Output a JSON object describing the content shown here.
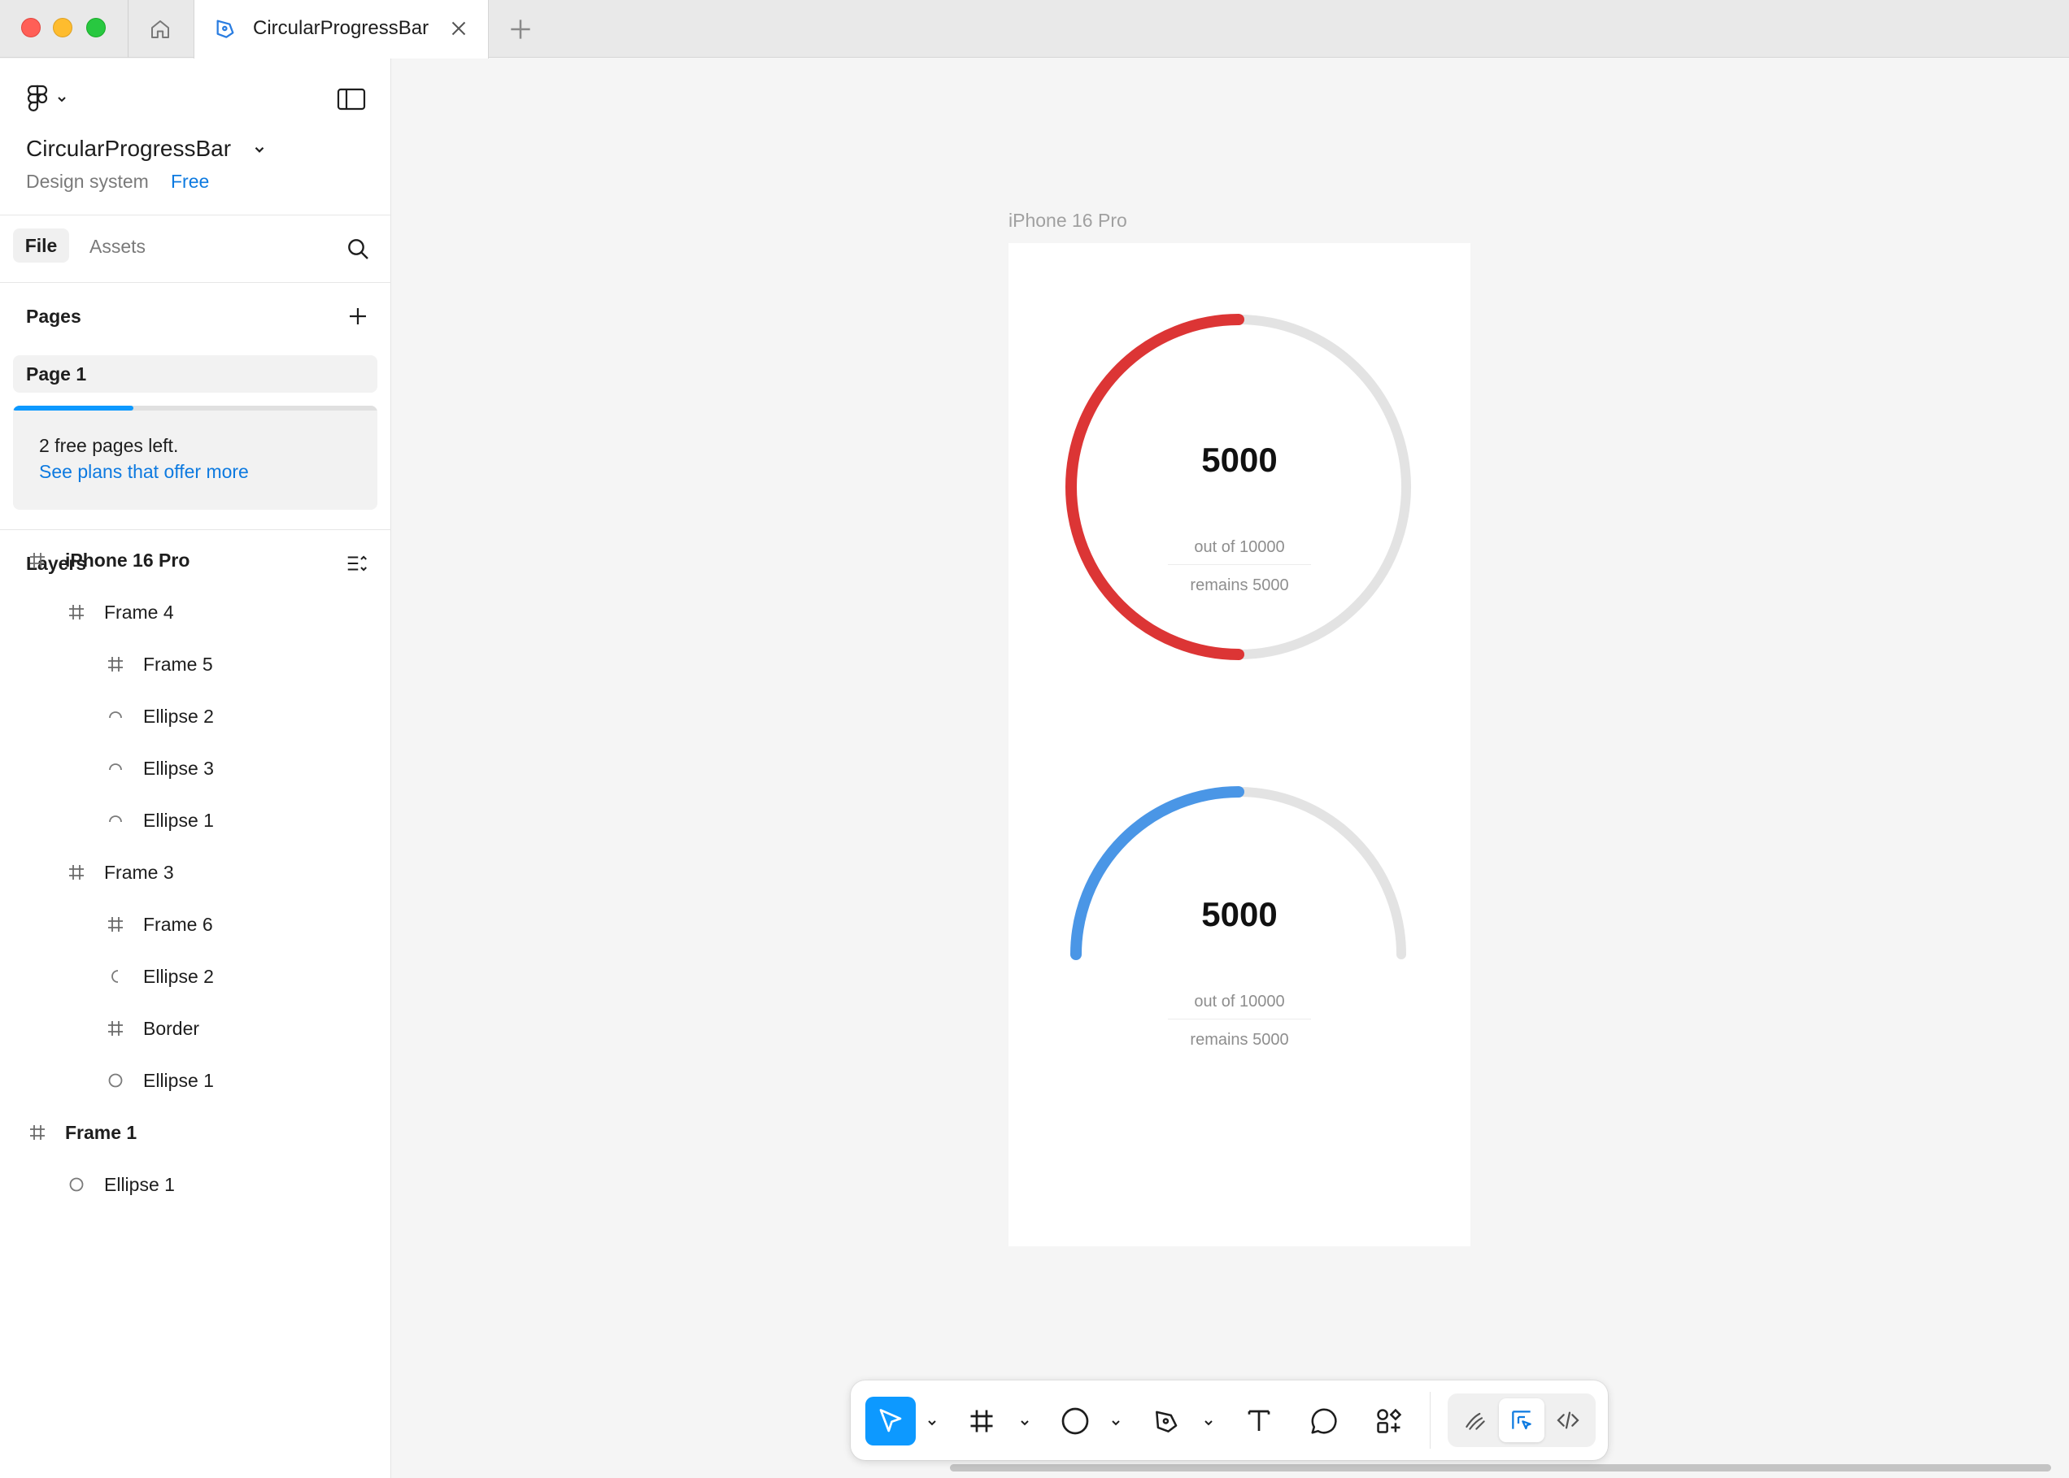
{
  "app": {
    "tab_title": "CircularProgressBar",
    "tab_icon": "figma-pen-icon"
  },
  "file": {
    "name": "CircularProgressBar",
    "subtitle": "Design system",
    "plan": "Free"
  },
  "panel_tabs": {
    "file": "File",
    "assets": "Assets"
  },
  "pages": {
    "title": "Pages",
    "items": [
      "Page 1"
    ],
    "upsell_text": "2 free pages left.",
    "upsell_link": "See plans that offer more",
    "usage_fraction": 0.33
  },
  "layers": {
    "title": "Layers",
    "items": [
      {
        "name": "iPhone 16 Pro",
        "icon": "frame-icon"
      },
      {
        "name": "Frame 4",
        "icon": "frame-icon"
      },
      {
        "name": "Frame 5",
        "icon": "frame-icon"
      },
      {
        "name": "Ellipse 2",
        "icon": "arc-icon"
      },
      {
        "name": "Ellipse 3",
        "icon": "arc-icon"
      },
      {
        "name": "Ellipse 1",
        "icon": "arc-icon"
      },
      {
        "name": "Frame 3",
        "icon": "frame-icon"
      },
      {
        "name": "Frame 6",
        "icon": "frame-icon"
      },
      {
        "name": "Ellipse 2",
        "icon": "half-ellipse-icon"
      },
      {
        "name": "Border",
        "icon": "frame-icon"
      },
      {
        "name": "Ellipse 1",
        "icon": "ellipse-icon"
      },
      {
        "name": "Frame 1",
        "icon": "frame-icon"
      },
      {
        "name": "Ellipse 1",
        "icon": "ellipse-icon"
      }
    ]
  },
  "canvas": {
    "frame_label": "iPhone 16 Pro",
    "circle_gauge": {
      "value": "5000",
      "total": "out of 10000",
      "remains": "remains 5000",
      "progress_fraction": 0.5,
      "color": "#dc3535"
    },
    "arc_gauge": {
      "value": "5000",
      "total": "out of 10000",
      "remains": "remains 5000",
      "progress_fraction": 0.5,
      "color": "#4a96e6"
    },
    "track_color": "#e3e3e3"
  },
  "toolbar": {
    "tools": [
      "move-tool",
      "frame-tool",
      "ellipse-tool",
      "pen-tool",
      "text-tool",
      "comment-tool",
      "actions-tool"
    ],
    "modes": [
      "draw-mode",
      "design-mode",
      "dev-mode"
    ],
    "accent": "#0d99ff"
  }
}
